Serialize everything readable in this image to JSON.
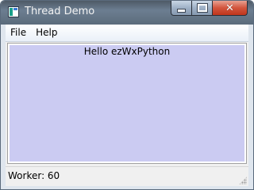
{
  "window": {
    "title": "Thread Demo",
    "icon": "app-icon",
    "controls": {
      "minimize_icon": "minimize-icon",
      "maximize_icon": "maximize-icon",
      "close_glyph": "✕"
    }
  },
  "menubar": {
    "items": [
      {
        "label": "File"
      },
      {
        "label": "Help"
      }
    ]
  },
  "panel": {
    "label": "Hello ezWxPython",
    "background_color": "#cbcbf2"
  },
  "statusbar": {
    "text": "Worker: 60"
  }
}
